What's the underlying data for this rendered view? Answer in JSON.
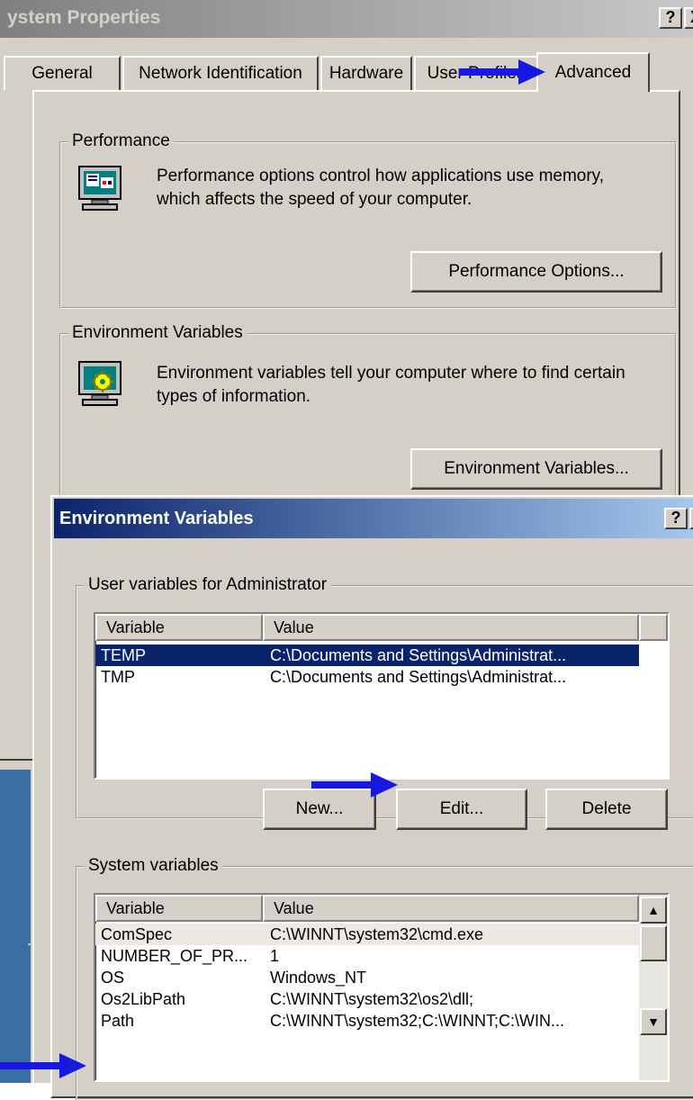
{
  "window": {
    "title": "ystem Properties",
    "help_button": "?",
    "close_button": "X",
    "tabs": [
      "General",
      "Network Identification",
      "Hardware",
      "User Profiles",
      "Advanced"
    ],
    "active_tab": "Advanced"
  },
  "performance": {
    "legend": "Performance",
    "description_line1": "Performance options control how applications use memory,",
    "description_line2": "which affects the speed of your computer.",
    "button": "Performance Options..."
  },
  "environment": {
    "legend": "Environment Variables",
    "description_line1": "Environment variables tell your computer where to find certain",
    "description_line2": "types of information.",
    "button": "Environment Variables..."
  },
  "env_dialog": {
    "title": "Environment Variables",
    "help_button": "?",
    "close_button": "X",
    "user_group": {
      "legend": "User variables for Administrator",
      "columns": [
        "Variable",
        "Value"
      ],
      "rows": [
        {
          "variable": "TEMP",
          "value": "C:\\Documents and Settings\\Administrat...",
          "selected": true
        },
        {
          "variable": "TMP",
          "value": "C:\\Documents and Settings\\Administrat...",
          "selected": false
        }
      ],
      "buttons": {
        "new": "New...",
        "edit": "Edit...",
        "delete": "Delete"
      }
    },
    "system_group": {
      "legend": "System variables",
      "columns": [
        "Variable",
        "Value"
      ],
      "rows": [
        {
          "variable": "ComSpec",
          "value": "C:\\WINNT\\system32\\cmd.exe"
        },
        {
          "variable": "NUMBER_OF_PR...",
          "value": "1"
        },
        {
          "variable": "OS",
          "value": "Windows_NT"
        },
        {
          "variable": "Os2LibPath",
          "value": "C:\\WINNT\\system32\\os2\\dll;"
        },
        {
          "variable": "Path",
          "value": "C:\\WINNT\\system32;C:\\WINNT;C:\\WIN..."
        }
      ]
    }
  },
  "colors": {
    "dialog_face": "#d4d0c8",
    "title_active_start": "#0a246a",
    "title_active_end": "#a6caf0",
    "title_inactive_start": "#808080",
    "title_inactive_end": "#c0c0c0",
    "selection": "#0a246a",
    "arrow": "#1818e0"
  },
  "icons": {
    "performance": "monitor-performance-icon",
    "environment": "monitor-settings-icon",
    "arrow": "blue-arrow-icon"
  }
}
